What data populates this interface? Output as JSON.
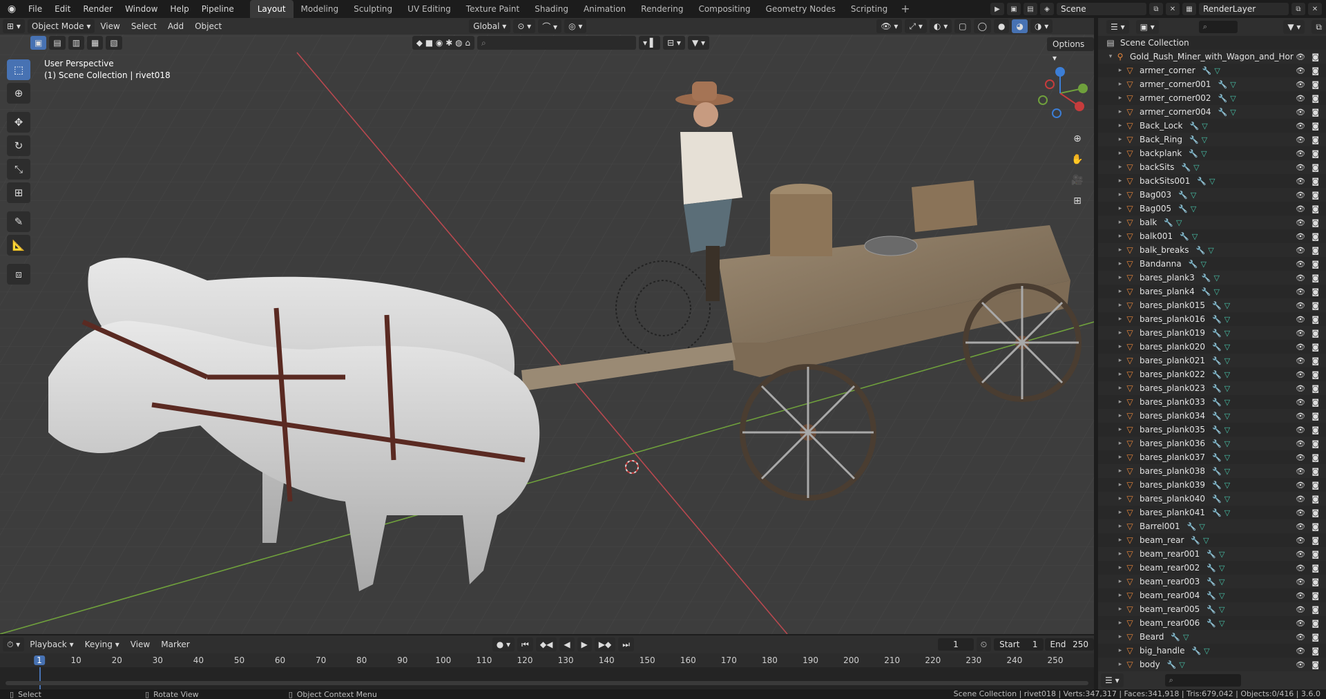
{
  "topbar": {
    "menus": [
      "File",
      "Edit",
      "Render",
      "Window",
      "Help",
      "Pipeline"
    ],
    "workspaces": [
      "Layout",
      "Modeling",
      "Sculpting",
      "UV Editing",
      "Texture Paint",
      "Shading",
      "Animation",
      "Rendering",
      "Compositing",
      "Geometry Nodes",
      "Scripting"
    ],
    "active_workspace": "Layout",
    "scene": "Scene",
    "render_layer": "RenderLayer"
  },
  "viewport": {
    "mode": "Object Mode",
    "menus": [
      "View",
      "Select",
      "Add",
      "Object"
    ],
    "orientation": "Global",
    "options_label": "Options",
    "info_line1": "User Perspective",
    "info_line2": "(1) Scene Collection | rivet018"
  },
  "outliner": {
    "root": "Scene Collection",
    "collection": "Gold_Rush_Miner_with_Wagon_and_Hor",
    "objects": [
      "armer_corner",
      "armer_corner001",
      "armer_corner002",
      "armer_corner004",
      "Back_Lock",
      "Back_Ring",
      "backplank",
      "backSits",
      "backSits001",
      "Bag003",
      "Bag005",
      "balk",
      "balk001",
      "balk_breaks",
      "Bandanna",
      "bares_plank3",
      "bares_plank4",
      "bares_plank015",
      "bares_plank016",
      "bares_plank019",
      "bares_plank020",
      "bares_plank021",
      "bares_plank022",
      "bares_plank023",
      "bares_plank033",
      "bares_plank034",
      "bares_plank035",
      "bares_plank036",
      "bares_plank037",
      "bares_plank038",
      "bares_plank039",
      "bares_plank040",
      "bares_plank041",
      "Barrel001",
      "beam_rear",
      "beam_rear001",
      "beam_rear002",
      "beam_rear003",
      "beam_rear004",
      "beam_rear005",
      "beam_rear006",
      "Beard",
      "big_handle",
      "body"
    ]
  },
  "timeline": {
    "menus": [
      "Playback",
      "Keying",
      "View",
      "Marker"
    ],
    "current_frame": "1",
    "start_label": "Start",
    "start": "1",
    "end_label": "End",
    "end": "250",
    "ticks": [
      "1",
      "10",
      "20",
      "30",
      "40",
      "50",
      "60",
      "70",
      "80",
      "90",
      "100",
      "110",
      "120",
      "130",
      "140",
      "150",
      "160",
      "170",
      "180",
      "190",
      "200",
      "210",
      "220",
      "230",
      "240",
      "250"
    ]
  },
  "statusbar": {
    "select": "Select",
    "rotate": "Rotate View",
    "context": "Object Context Menu",
    "stats": "Scene Collection | rivet018 | Verts:347,317 | Faces:341,918 | Tris:679,042 | Objects:0/416 | 3.6.0"
  },
  "colors": {
    "accent": "#4772b3",
    "object_icon": "#e9863a",
    "mesh_icon": "#47c2a8",
    "modifier_icon": "#6d8fd8"
  }
}
